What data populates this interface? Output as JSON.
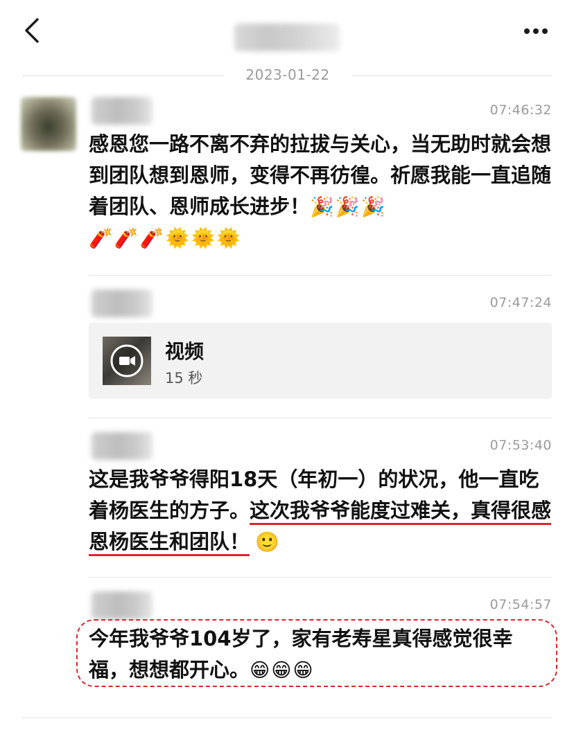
{
  "header": {
    "back_icon": "chevron-left-icon",
    "more_icon": "more-dots-icon"
  },
  "date_separator": "2023-01-22",
  "messages": [
    {
      "time": "07:46:32",
      "text": "感恩您一路不离不弃的拉拔与关心，当无助时就会想到团队想到恩师，变得不再彷徨。祈愿我能一直追随着团队、恩师成长进步！",
      "emoji_trail": "🎉🎉🎉",
      "emoji_line": "🧨🧨🧨🌞🌞🌞"
    },
    {
      "time": "07:47:24",
      "video": {
        "title": "视频",
        "duration": "15 秒",
        "icon": "video-camera-icon"
      }
    },
    {
      "time": "07:53:40",
      "text_plain": "这是我爷爷得阳18天（年初一）的状况，他一直吃着杨医生的方子。",
      "text_underlined": "这次我爷爷能度过难关，真得很感恩杨医生和团队！",
      "emoji": "🙂"
    },
    {
      "time": "07:54:57",
      "text": "今年我爷爷104岁了，家有老寿星真得感觉很幸福，想想都开心。",
      "emoji": "😁😁😁"
    }
  ],
  "colors": {
    "accent_red": "#d9262b",
    "timestamp_gray": "#9a9a9a",
    "card_bg": "#f2f2f2"
  }
}
